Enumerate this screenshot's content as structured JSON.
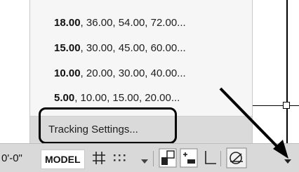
{
  "spacing_menu": {
    "items": [
      {
        "primary": "18.00",
        "rest": ", 36.00, 54.00, 72.00..."
      },
      {
        "primary": "15.00",
        "rest": ", 30.00, 45.00, 60.00..."
      },
      {
        "primary": "10.00",
        "rest": ", 20.00, 30.00, 40.00..."
      },
      {
        "primary": "5.00",
        "rest": ", 10.00, 15.00, 20.00..."
      }
    ],
    "settings_label": "Tracking Settings..."
  },
  "statusbar": {
    "coordinates": "0'-0\"",
    "model_label": "MODEL",
    "icons": [
      "grid-icon",
      "snap-icon",
      "dropdown-arrow-icon",
      "infer-constraints-icon",
      "dynamic-input-icon",
      "ortho-icon",
      "polar-tracking-icon",
      "polar-dropdown-icon"
    ]
  },
  "colors": {
    "menu_background": "#f6f6f6",
    "highlight_background": "#dadada",
    "statusbar_background": "#d9d9d9",
    "annotation": "#000000"
  }
}
